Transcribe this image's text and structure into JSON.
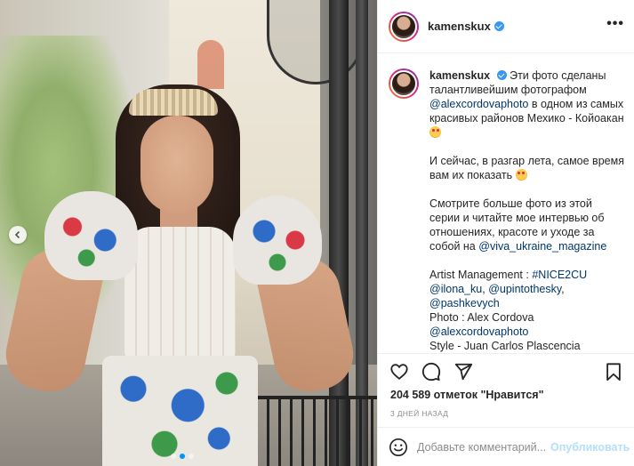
{
  "post": {
    "username": "kamenskux",
    "verified": true,
    "more_label": "•••"
  },
  "caption": {
    "p1_start": "Эти фото сделаны талантливейшим фотографом",
    "p1_mention": "@alexcordovaphoto",
    "p1_end": "в одном из самых красивых районов Мехико - Койоакан",
    "p2": "И сейчас, в разгар лета, самое время вам их показать",
    "p3_start": "Смотрите больше фото из этой серии и читайте мое интервью об отношениях, красоте и уходе за собой на",
    "p3_mention": "@viva_ukraine_magazine",
    "am_label": "Artist Management :",
    "am_tag": "#NICE2CU",
    "am_mention1": "@ilona_ku",
    "am_mention2": "@upintothesky",
    "am_mention3": "@pashkevych",
    "photo_credit": "Photo : Alex Cordova",
    "photo_mention": "@alexcordovaphoto",
    "style_credit": "Style - Juan Carlos Plascencia"
  },
  "actions": {
    "like_icon": "heart-icon",
    "comment_icon": "comment-icon",
    "share_icon": "paper-plane-icon",
    "save_icon": "bookmark-icon"
  },
  "likes_text": "204 589 отметок \"Нравится\"",
  "date_text": "3 ДНЕЙ НАЗАД",
  "comment_box": {
    "placeholder": "Добавьте комментарий...",
    "publish_label": "Опубликовать"
  },
  "colors": {
    "link": "#00376b",
    "accent": "#0095f6",
    "publish_disabled": "#b2dffc",
    "verified": "#3897f0"
  }
}
